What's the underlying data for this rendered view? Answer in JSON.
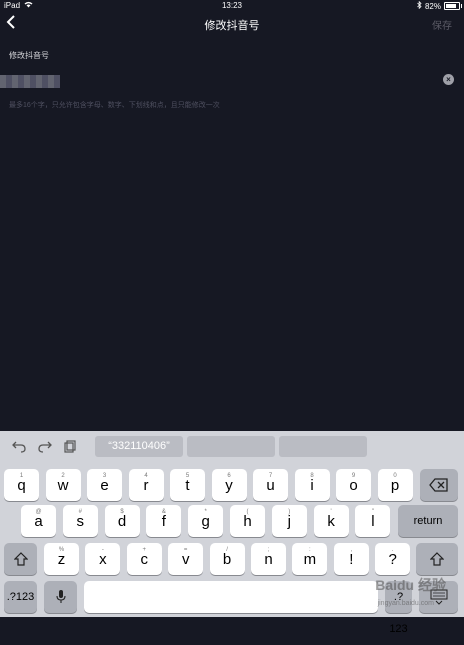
{
  "status": {
    "device": "iPad",
    "time": "13:23",
    "battery": "82%",
    "battery_level": 0.82
  },
  "nav": {
    "back_glyph": "‹",
    "title": "修改抖音号",
    "save": "保存"
  },
  "form": {
    "label": "修改抖音号",
    "hint": "最多16个字，只允许包含字母、数字、下划线和点，且只能修改一次"
  },
  "keyboard": {
    "prediction": "“332110406”",
    "row1": [
      {
        "k": "q",
        "s": "1"
      },
      {
        "k": "w",
        "s": "2"
      },
      {
        "k": "e",
        "s": "3"
      },
      {
        "k": "r",
        "s": "4"
      },
      {
        "k": "t",
        "s": "5"
      },
      {
        "k": "y",
        "s": "6"
      },
      {
        "k": "u",
        "s": "7"
      },
      {
        "k": "i",
        "s": "8"
      },
      {
        "k": "o",
        "s": "9"
      },
      {
        "k": "p",
        "s": "0"
      }
    ],
    "row2": [
      {
        "k": "a",
        "s": "@"
      },
      {
        "k": "s",
        "s": "#"
      },
      {
        "k": "d",
        "s": "$"
      },
      {
        "k": "f",
        "s": "&"
      },
      {
        "k": "g",
        "s": "*"
      },
      {
        "k": "h",
        "s": "("
      },
      {
        "k": "j",
        "s": ")"
      },
      {
        "k": "k",
        "s": "'"
      },
      {
        "k": "l",
        "s": "\""
      }
    ],
    "row3": [
      {
        "k": "z",
        "s": "%"
      },
      {
        "k": "x",
        "s": "-"
      },
      {
        "k": "c",
        "s": "+"
      },
      {
        "k": "v",
        "s": "="
      },
      {
        "k": "b",
        "s": "/"
      },
      {
        "k": "n",
        "s": ";"
      },
      {
        "k": "m",
        "s": ":"
      },
      {
        "k": "!",
        "s": ","
      },
      {
        "k": "?",
        "s": "."
      }
    ],
    "return": "return",
    "num_left": ".?123",
    "num_right": ".?123",
    "watermark": "Baidu 经验",
    "watermark_sub": "jingyan.baidu.com"
  }
}
